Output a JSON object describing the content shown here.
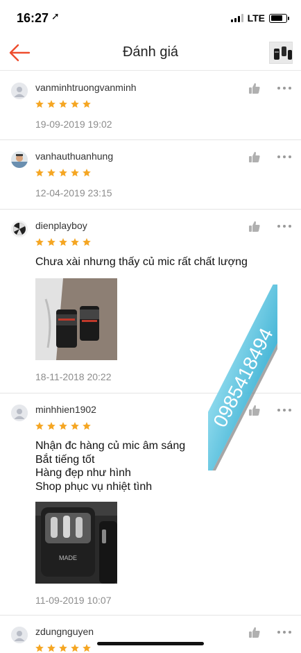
{
  "status_bar": {
    "time": "16:27",
    "network": "LTE",
    "battery_level": 0.8
  },
  "nav": {
    "title": "Đánh giá",
    "back_icon": "back-arrow-icon",
    "accent_color": "#ee4d2d"
  },
  "colors": {
    "star": "#f5a623",
    "watermark": "#29b6d8"
  },
  "reviews": [
    {
      "username": "vanminhtruongvanminh",
      "rating": 5,
      "date": "19-09-2019 19:02",
      "comment": []
    },
    {
      "username": "vanhauthuanhung",
      "rating": 5,
      "date": "12-04-2019 23:15",
      "comment": []
    },
    {
      "username": "dienplayboy",
      "rating": 5,
      "date": "18-11-2018 20:22",
      "comment": [
        "Chưa xài nhưng thấy củ mic rất chất lượng"
      ]
    },
    {
      "username": "minhhien1902",
      "rating": 5,
      "date": "11-09-2019 10:07",
      "comment": [
        "Nhận đc hàng củ mic âm sáng",
        "Bắt tiếng tốt",
        "Hàng đẹp như hình",
        "Shop phục vụ nhiệt tình"
      ]
    },
    {
      "username": "zdungnguyen",
      "rating": 5,
      "date": "",
      "comment": []
    }
  ],
  "watermark": {
    "text": "0985418494"
  }
}
